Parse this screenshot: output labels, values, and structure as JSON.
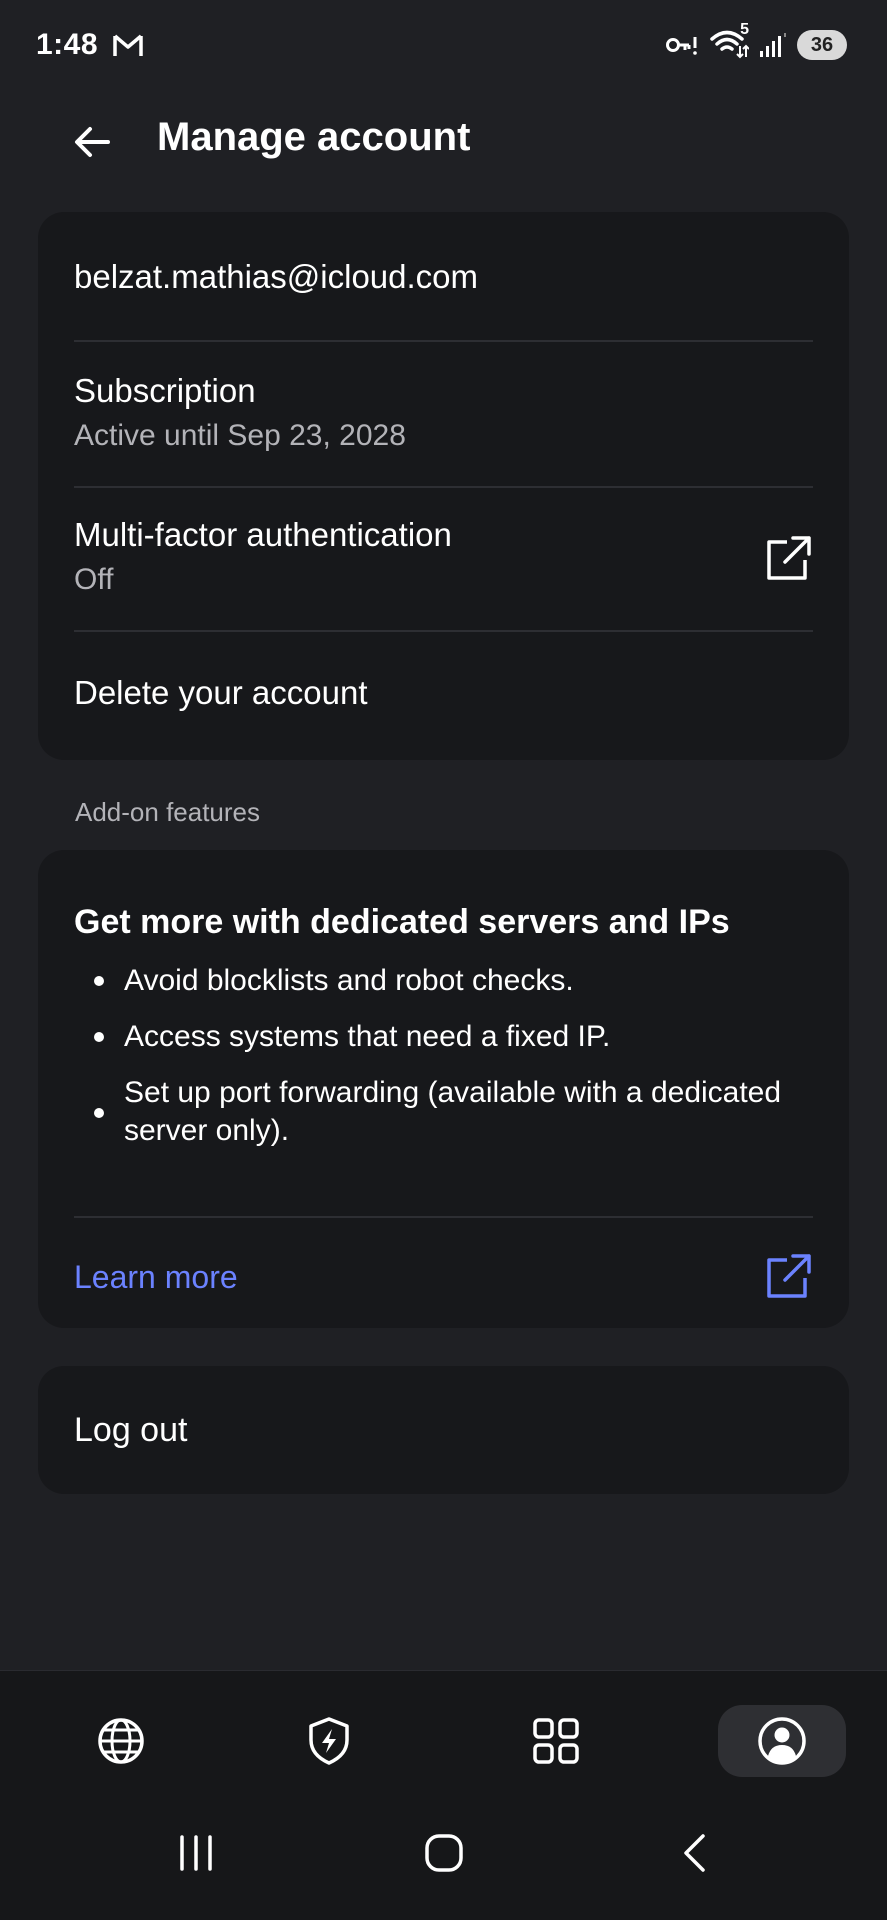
{
  "status_bar": {
    "time": "1:48",
    "network_label": "5",
    "battery": "36",
    "icons": [
      "gmail-icon",
      "vpn-key-icon",
      "wifi-icon",
      "signal-icon",
      "battery-icon"
    ]
  },
  "header": {
    "title": "Manage account",
    "back_icon": "arrow-left-icon"
  },
  "account": {
    "email": "belzat.mathias@icloud.com",
    "subscription_title": "Subscription",
    "subscription_status": "Active until Sep 23, 2028",
    "mfa_title": "Multi-factor authentication",
    "mfa_status": "Off",
    "mfa_icon": "external-link-icon",
    "delete_label": "Delete your account"
  },
  "addons": {
    "section_label": "Add-on features",
    "title": "Get more with dedicated servers and IPs",
    "bullets": [
      "Avoid blocklists and robot checks.",
      "Access systems that need a fixed IP.",
      "Set up port forwarding (available with a dedicated server only)."
    ],
    "learn_more_label": "Learn more",
    "learn_more_icon": "external-link-icon"
  },
  "logout": {
    "label": "Log out"
  },
  "bottom_nav": {
    "items": [
      {
        "icon": "globe-icon",
        "active": false
      },
      {
        "icon": "shield-bolt-icon",
        "active": false
      },
      {
        "icon": "grid-icon",
        "active": false
      },
      {
        "icon": "account-icon",
        "active": true
      }
    ]
  },
  "colors": {
    "background": "#1f2024",
    "card": "#17181b",
    "link": "#6b82ff",
    "secondary_text": "#b3b3b8"
  }
}
